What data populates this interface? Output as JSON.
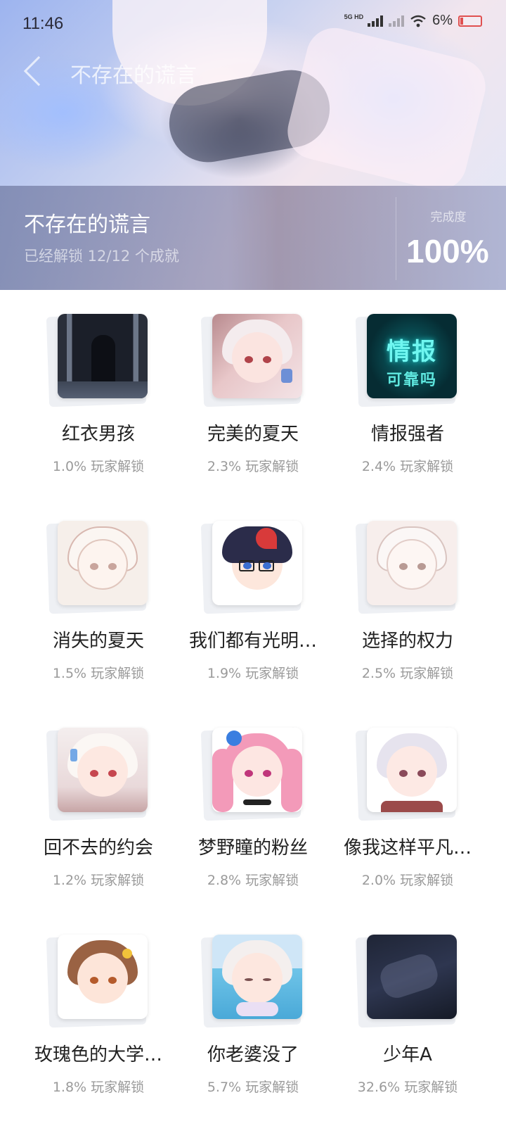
{
  "status_bar": {
    "time": "11:46",
    "network": "5G HD",
    "battery": "6%"
  },
  "header": {
    "nav_title": "不存在的谎言",
    "game_title": "不存在的谎言",
    "unlock_text": "已经解锁 12/12 个成就",
    "progress_label": "完成度",
    "progress_value": "100%"
  },
  "achievements": [
    {
      "name": "红衣男孩",
      "rate": "1.0% 玩家解锁",
      "icon": "dark-window-ghost-icon"
    },
    {
      "name": "完美的夏天",
      "rate": "2.3% 玩家解锁",
      "icon": "white-hair-girl-icon"
    },
    {
      "name": "情报强者",
      "rate": "2.4% 玩家解锁",
      "icon": "intel-text-icon",
      "art_line1": "情报",
      "art_line2": "可靠吗"
    },
    {
      "name": "消失的夏天",
      "rate": "1.5% 玩家解锁",
      "icon": "sketch-girl-icon"
    },
    {
      "name": "我们都有光明…",
      "rate": "1.9% 玩家解锁",
      "icon": "glasses-boy-icon"
    },
    {
      "name": "选择的权力",
      "rate": "2.5% 玩家解锁",
      "icon": "sketch-girl-2-icon"
    },
    {
      "name": "回不去的约会",
      "rate": "1.2% 玩家解锁",
      "icon": "white-hair-girl-2-icon"
    },
    {
      "name": "梦野瞳的粉丝",
      "rate": "2.8% 玩家解锁",
      "icon": "pink-hair-girl-icon"
    },
    {
      "name": "像我这样平凡…",
      "rate": "2.0% 玩家解锁",
      "icon": "silver-hair-girl-icon"
    },
    {
      "name": "玫瑰色的大学…",
      "rate": "1.8% 玩家解锁",
      "icon": "brown-hair-girl-icon"
    },
    {
      "name": "你老婆没了",
      "rate": "5.7% 玩家解锁",
      "icon": "pool-girl-icon"
    },
    {
      "name": "少年A",
      "rate": "32.6% 玩家解锁",
      "icon": "dark-scene-icon"
    }
  ]
}
